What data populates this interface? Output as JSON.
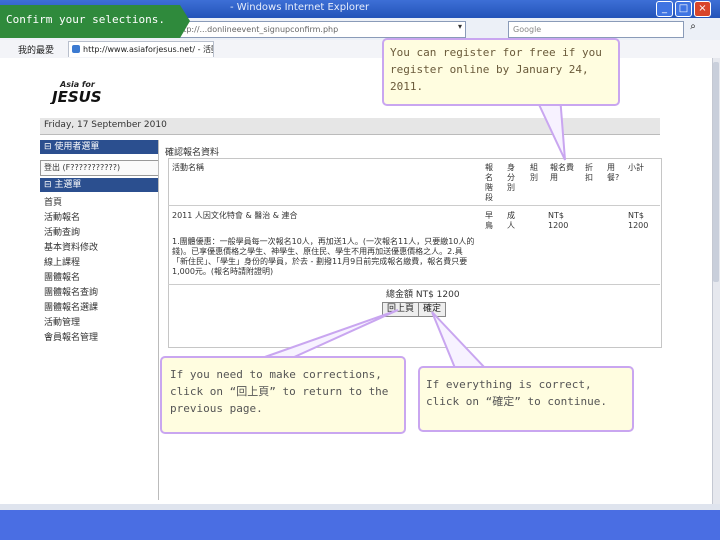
{
  "window": {
    "title": "- Windows Internet Explorer",
    "btn_min": "_",
    "btn_max": "□",
    "btn_close": "×"
  },
  "browser": {
    "address_value": "http://...donlineevent_signupconfirm.php",
    "go_glyph": "▾",
    "search_placeholder": "Google",
    "favorites_label": "我的最愛",
    "tab_label": "http://www.asiaforjesus.net/ - 活動報名"
  },
  "banner": {
    "text": "Confirm your selections.",
    "color": "#2f8a3c"
  },
  "site": {
    "logo_line1": "Asia for",
    "logo_line2": "JESUS",
    "date": "Friday, 17 September 2010"
  },
  "sidebar": {
    "user_menu_header": "使用者選單",
    "member_field": "登出 (F???????????)",
    "main_menu_header": "主選單",
    "items": [
      "首頁",
      "活動報名",
      "活動查詢",
      "基本資料修改",
      "線上課程",
      "團體報名",
      "團體報名查詢",
      "團體報名選課",
      "活動管理",
      "會員報名管理"
    ]
  },
  "content": {
    "title": "確認報名資料",
    "col_activity": "活動名稱",
    "col_group": "報名階段",
    "col_type": "身分別",
    "col_class": "組別",
    "col_price": "報名費用",
    "col_discount": "折扣",
    "col_meal": "用餐?",
    "col_subtotal": "小計",
    "row_name": "2011 人因文化特會 & 醫治 & 連合",
    "row_group": "早鳥",
    "row_type": "成人",
    "row_price": "NT$ 1200",
    "row_subtotal": "NT$ 1200",
    "row_note": "1.團體優惠：一般學員每一次報名10人，再加送1人。(一次報名11人，只要繳10人的錢)。已享優惠價格之學生、神學生、原住民、學生不用再加送優惠價格之人。2.具「新住民」、「學生」身份的學員，於去 - 劃撥11月9日前完成報名繳費，報名費只要1,000元。(報名時請附證明)",
    "total": "總金額 NT$ 1200",
    "prev_button": "回上頁",
    "confirm_button": "確定"
  },
  "callouts": {
    "top": "You can register for free if you register online by January 24, 2011.",
    "left": "If you need to make corrections, click on “回上頁” to return to the previous page.",
    "right": "If everything is correct, click on “確定” to continue."
  }
}
